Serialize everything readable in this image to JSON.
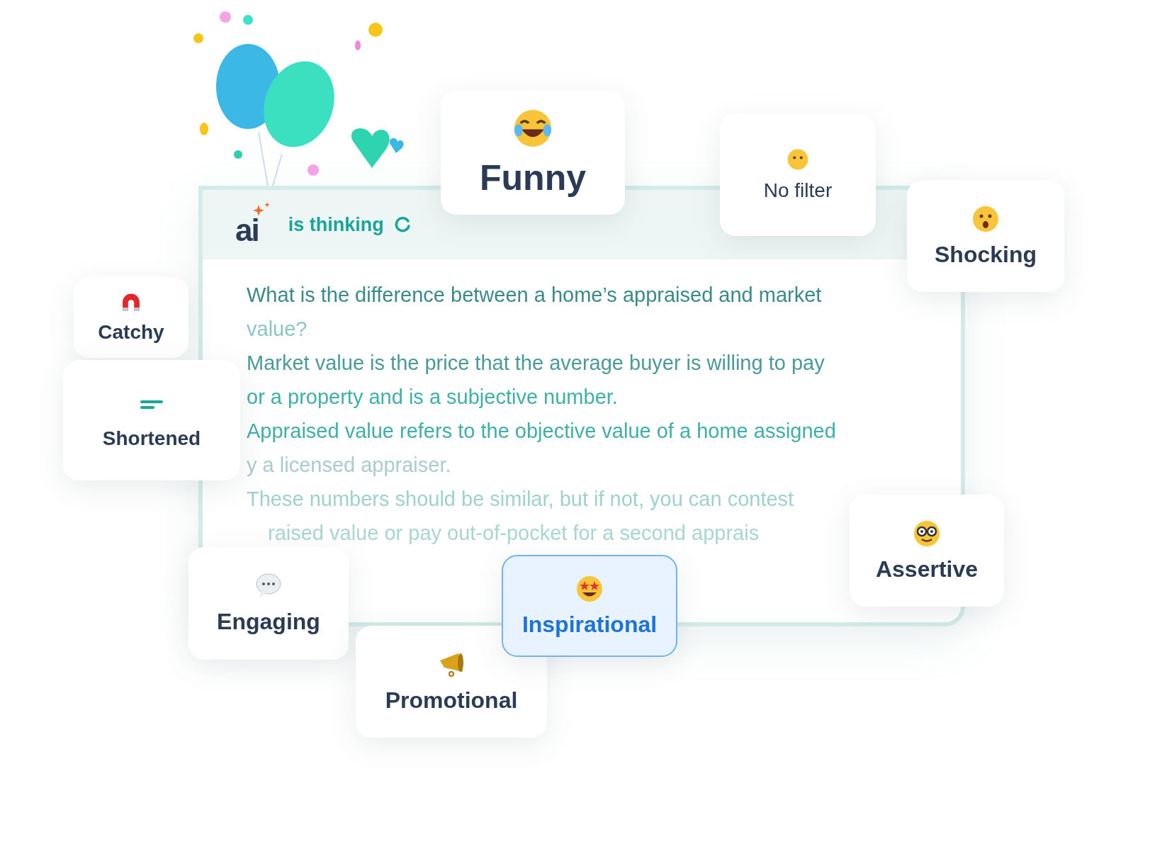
{
  "header": {
    "logo": "ai",
    "status": "is thinking"
  },
  "answer_lines": [
    "What is the difference between a home’s appraised and market",
    "value?",
    "Market value is the price that the average buyer is willing to pay",
    "or a property and is a subjective number.",
    "Appraised value refers to the objective value of a home assigned",
    "y a licensed appraiser.",
    "These numbers should be similar, but if not, you can contest",
    "raised value or pay out-of-pocket for a second apprais"
  ],
  "tones": [
    {
      "label": "Funny",
      "kind": "laugh",
      "selected": false
    },
    {
      "label": "No filter",
      "kind": "neutral",
      "selected": false
    },
    {
      "label": "Shocking",
      "kind": "surprised",
      "selected": false
    },
    {
      "label": "Catchy",
      "kind": "magnet",
      "selected": false
    },
    {
      "label": "Shortened",
      "kind": "lines",
      "selected": false
    },
    {
      "label": "Engaging",
      "kind": "speech",
      "selected": false
    },
    {
      "label": "Promotional",
      "kind": "megaphone",
      "selected": false
    },
    {
      "label": "Inspirational",
      "kind": "starstruck",
      "selected": true
    },
    {
      "label": "Assertive",
      "kind": "nerd",
      "selected": false
    }
  ]
}
